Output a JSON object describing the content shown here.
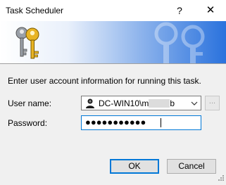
{
  "window": {
    "title": "Task Scheduler",
    "help_glyph": "?",
    "close_glyph": "✕"
  },
  "banner": {
    "icon": "keys-icon",
    "accent": "#2a72dd"
  },
  "form": {
    "instruction": "Enter user account information for running this task.",
    "user_label": "User name:",
    "user_value_prefix": "DC-WIN10\\m",
    "user_value_suffix": "b",
    "browse_label": "...",
    "password_label": "Password:",
    "password_masked": "●●●●●●●●●●●"
  },
  "buttons": {
    "ok_label": "OK",
    "cancel_label": "Cancel"
  },
  "colors": {
    "focus": "#0078d7",
    "dialog_bg": "#f0f0f0"
  }
}
